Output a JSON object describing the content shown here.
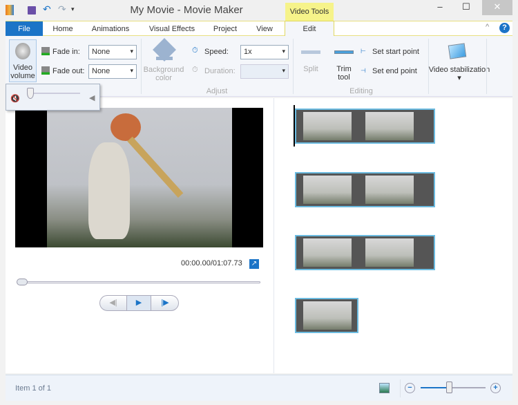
{
  "window": {
    "title": "My Movie - Movie Maker",
    "contextual_tab": "Video Tools",
    "minimize": "‒",
    "maximize": "☐",
    "close": "✕"
  },
  "tabs": [
    {
      "label": "File"
    },
    {
      "label": "Home"
    },
    {
      "label": "Animations"
    },
    {
      "label": "Visual Effects"
    },
    {
      "label": "Project"
    },
    {
      "label": "View"
    },
    {
      "label": "Edit"
    }
  ],
  "ribbon": {
    "video_volume": "Video volume",
    "fade_in_label": "Fade in:",
    "fade_in_value": "None",
    "fade_out_label": "Fade out:",
    "fade_out_value": "None",
    "background_color": "Background color",
    "speed_label": "Speed:",
    "speed_value": "1x",
    "duration_label": "Duration:",
    "duration_value": "",
    "adjust_group": "Adjust",
    "split": "Split",
    "trim_tool": "Trim tool",
    "set_start": "Set start point",
    "set_end": "Set end point",
    "editing_group": "Editing",
    "video_stabilization": "Video stabilization",
    "help": "?",
    "collapse": "^"
  },
  "volume_popup": {
    "level": 0.1
  },
  "preview": {
    "time": "00:00.00/01:07.73",
    "seek_position": 0
  },
  "storyboard": {
    "clip_count": 4
  },
  "status": {
    "text": "Item 1 of 1",
    "zoom_level": 0.45
  },
  "colors": {
    "accent": "#1b74c7",
    "contextual": "#f6f38a",
    "clip_border": "#6bbbe0"
  }
}
